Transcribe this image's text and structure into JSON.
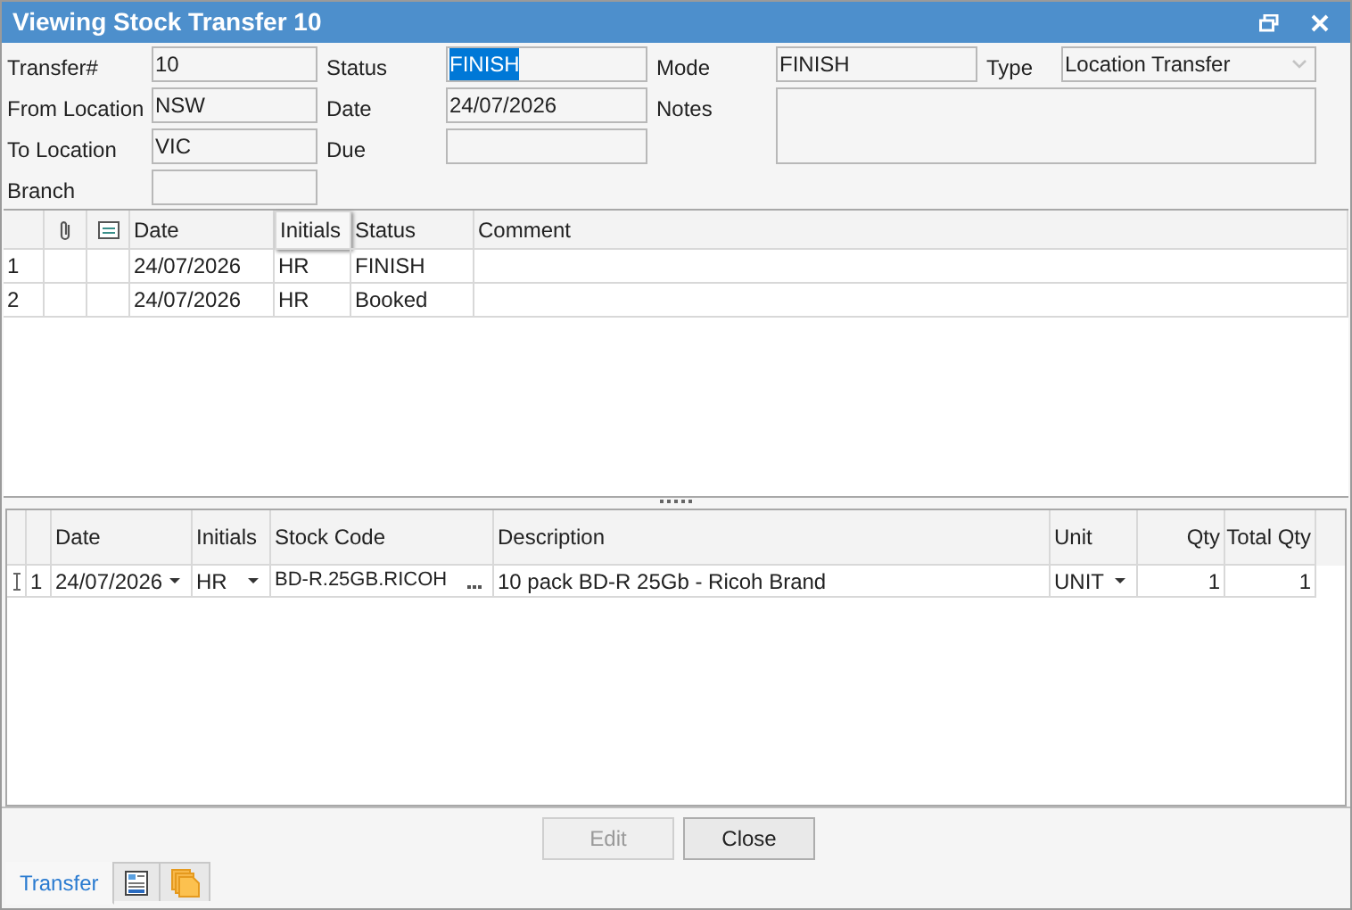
{
  "window": {
    "title": "Viewing Stock Transfer 10"
  },
  "form": [
    {
      "label": "Transfer#",
      "value": "10",
      "kind": "text"
    },
    {
      "label": "Status",
      "value": "FINISH",
      "kind": "text",
      "highlighted": true
    },
    {
      "label": "Mode",
      "value": "FINISH",
      "kind": "text"
    },
    {
      "label": "Type",
      "value": "Location Transfer",
      "kind": "select"
    },
    {
      "label": "From Location",
      "value": "NSW",
      "kind": "text"
    },
    {
      "label": "Date",
      "value": "24/07/2026",
      "kind": "text"
    },
    {
      "label": "Notes",
      "kind": "memo"
    },
    {
      "label": "To Location",
      "value": "VIC",
      "kind": "text"
    },
    {
      "label": "Due",
      "kind": "text"
    },
    {
      "label": "Branch",
      "kind": "text"
    }
  ],
  "history_table": {
    "columns": [
      "Date",
      "Initials",
      "Status",
      "Comment"
    ],
    "rows": [
      {
        "row": "1",
        "date": "24/07/2026",
        "initials": "HR",
        "status": "FINISH"
      },
      {
        "row": "2",
        "date": "24/07/2026",
        "initials": "HR",
        "status": "Booked"
      }
    ]
  },
  "lines_table": {
    "columns": [
      "Date",
      "Initials",
      "Stock Code",
      "Description",
      "Unit",
      "Qty",
      "Total Qty"
    ],
    "rows": [
      {
        "row": "1",
        "date": "24/07/2026",
        "initials": "HR",
        "stock_code": "BD-R.25GB.RICOH",
        "description": "10 pack BD-R 25Gb - Ricoh Brand",
        "unit": "UNIT",
        "qty": "1",
        "total_qty": "1"
      }
    ]
  },
  "buttons": [
    {
      "label": "Edit",
      "disabled": true
    },
    {
      "label": "Close",
      "disabled": false
    }
  ],
  "bottom_tabs": [
    {
      "kind": "text",
      "label": "Transfer",
      "selected": true
    },
    {
      "kind": "form-icon",
      "selected": false
    },
    {
      "kind": "pages-icon",
      "selected": false
    }
  ]
}
